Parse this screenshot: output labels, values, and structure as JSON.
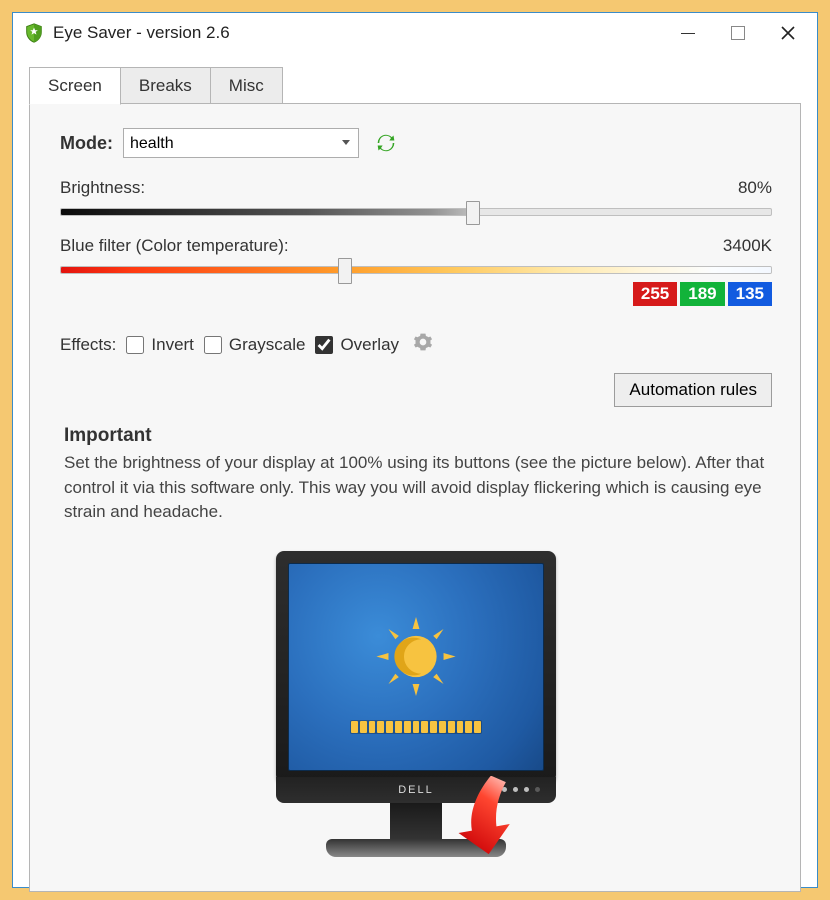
{
  "title": "Eye Saver - version 2.6",
  "tabs": {
    "screen": "Screen",
    "breaks": "Breaks",
    "misc": "Misc"
  },
  "mode": {
    "label": "Mode:",
    "value": "health"
  },
  "brightness": {
    "label": "Brightness:",
    "value": "80%",
    "percent": 58
  },
  "bluefilter": {
    "label": "Blue filter (Color temperature):",
    "value": "3400K",
    "thumb_percent": 40
  },
  "rgb": {
    "r": "255",
    "g": "189",
    "b": "135"
  },
  "effects": {
    "label": "Effects:",
    "invert": "Invert",
    "grayscale": "Grayscale",
    "overlay": "Overlay",
    "overlay_checked": true
  },
  "automation_button": "Automation rules",
  "important": {
    "heading": "Important",
    "text": "Set the brightness of your display at 100% using its buttons (see the picture below). After that control it via this software only. This way you will avoid display flickering which is causing eye strain and headache."
  },
  "monitor_brand": "DELL"
}
